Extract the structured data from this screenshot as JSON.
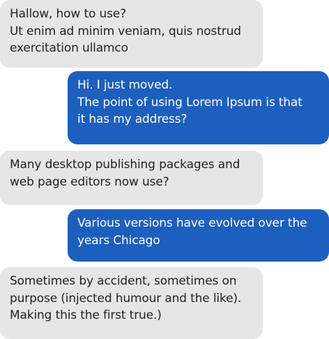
{
  "messages": [
    {
      "direction": "incoming",
      "lines": [
        "Hallow, how to use?",
        "Ut enim ad minim veniam, quis nostrud",
        "exercitation ullamco"
      ]
    },
    {
      "direction": "outgoing",
      "lines": [
        "Hi. I just moved.",
        "The point of using Lorem Ipsum is that",
        "it has my address?"
      ]
    },
    {
      "direction": "incoming",
      "lines": [
        "Many desktop publishing packages and",
        "web page editors now use?"
      ]
    },
    {
      "direction": "outgoing",
      "lines": [
        "Various versions have evolved over the",
        "years Chicago"
      ]
    },
    {
      "direction": "incoming",
      "lines": [
        "Sometimes by accident, sometimes on",
        "purpose (injected humour and the like).",
        "Making this the first true.)"
      ]
    }
  ],
  "colors": {
    "incoming_bubble": "#e6e6e6",
    "incoming_text": "#222222",
    "outgoing_bubble": "#1d5fbf",
    "outgoing_text": "#ffffff"
  }
}
